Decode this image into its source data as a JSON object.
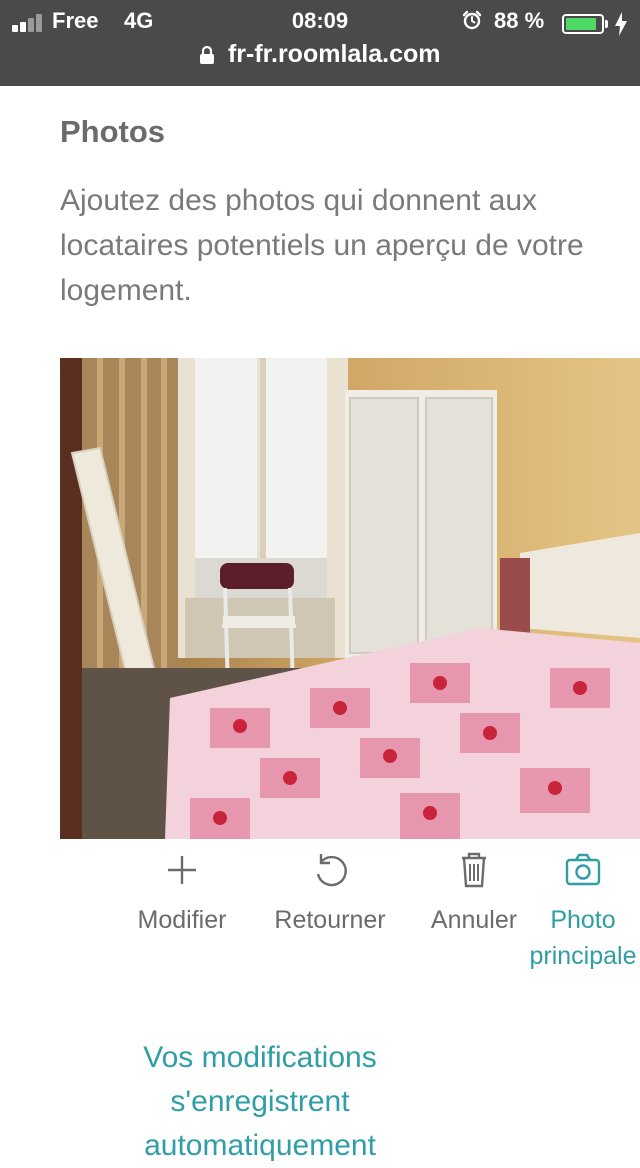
{
  "status_bar": {
    "carrier": "Free",
    "network": "4G",
    "time": "08:09",
    "battery_percent": "88 %",
    "battery_level": 0.88,
    "url": "fr-fr.roomlala.com",
    "icons": [
      "signal-icon",
      "alarm-icon",
      "battery-icon",
      "charging-icon",
      "lock-icon"
    ]
  },
  "section": {
    "title": "Photos",
    "description": "Ajoutez des photos qui donnent aux locataires potentiels un aperçu de votre logement."
  },
  "photo_actions": [
    {
      "label": "Modifier",
      "icon": "plus-icon"
    },
    {
      "label": "Retourner",
      "icon": "rotate-icon"
    },
    {
      "label": "Annuler",
      "icon": "trash-icon"
    },
    {
      "label": "Photo principale",
      "icon": "camera-icon"
    }
  ],
  "save_note": "Vos modifications s'enregistrent automatiquement",
  "colors": {
    "status_bar_bg": "#4a4a4a",
    "accent": "#2f9ea6",
    "battery": "#4cd964",
    "text": "#6b6b6b"
  }
}
